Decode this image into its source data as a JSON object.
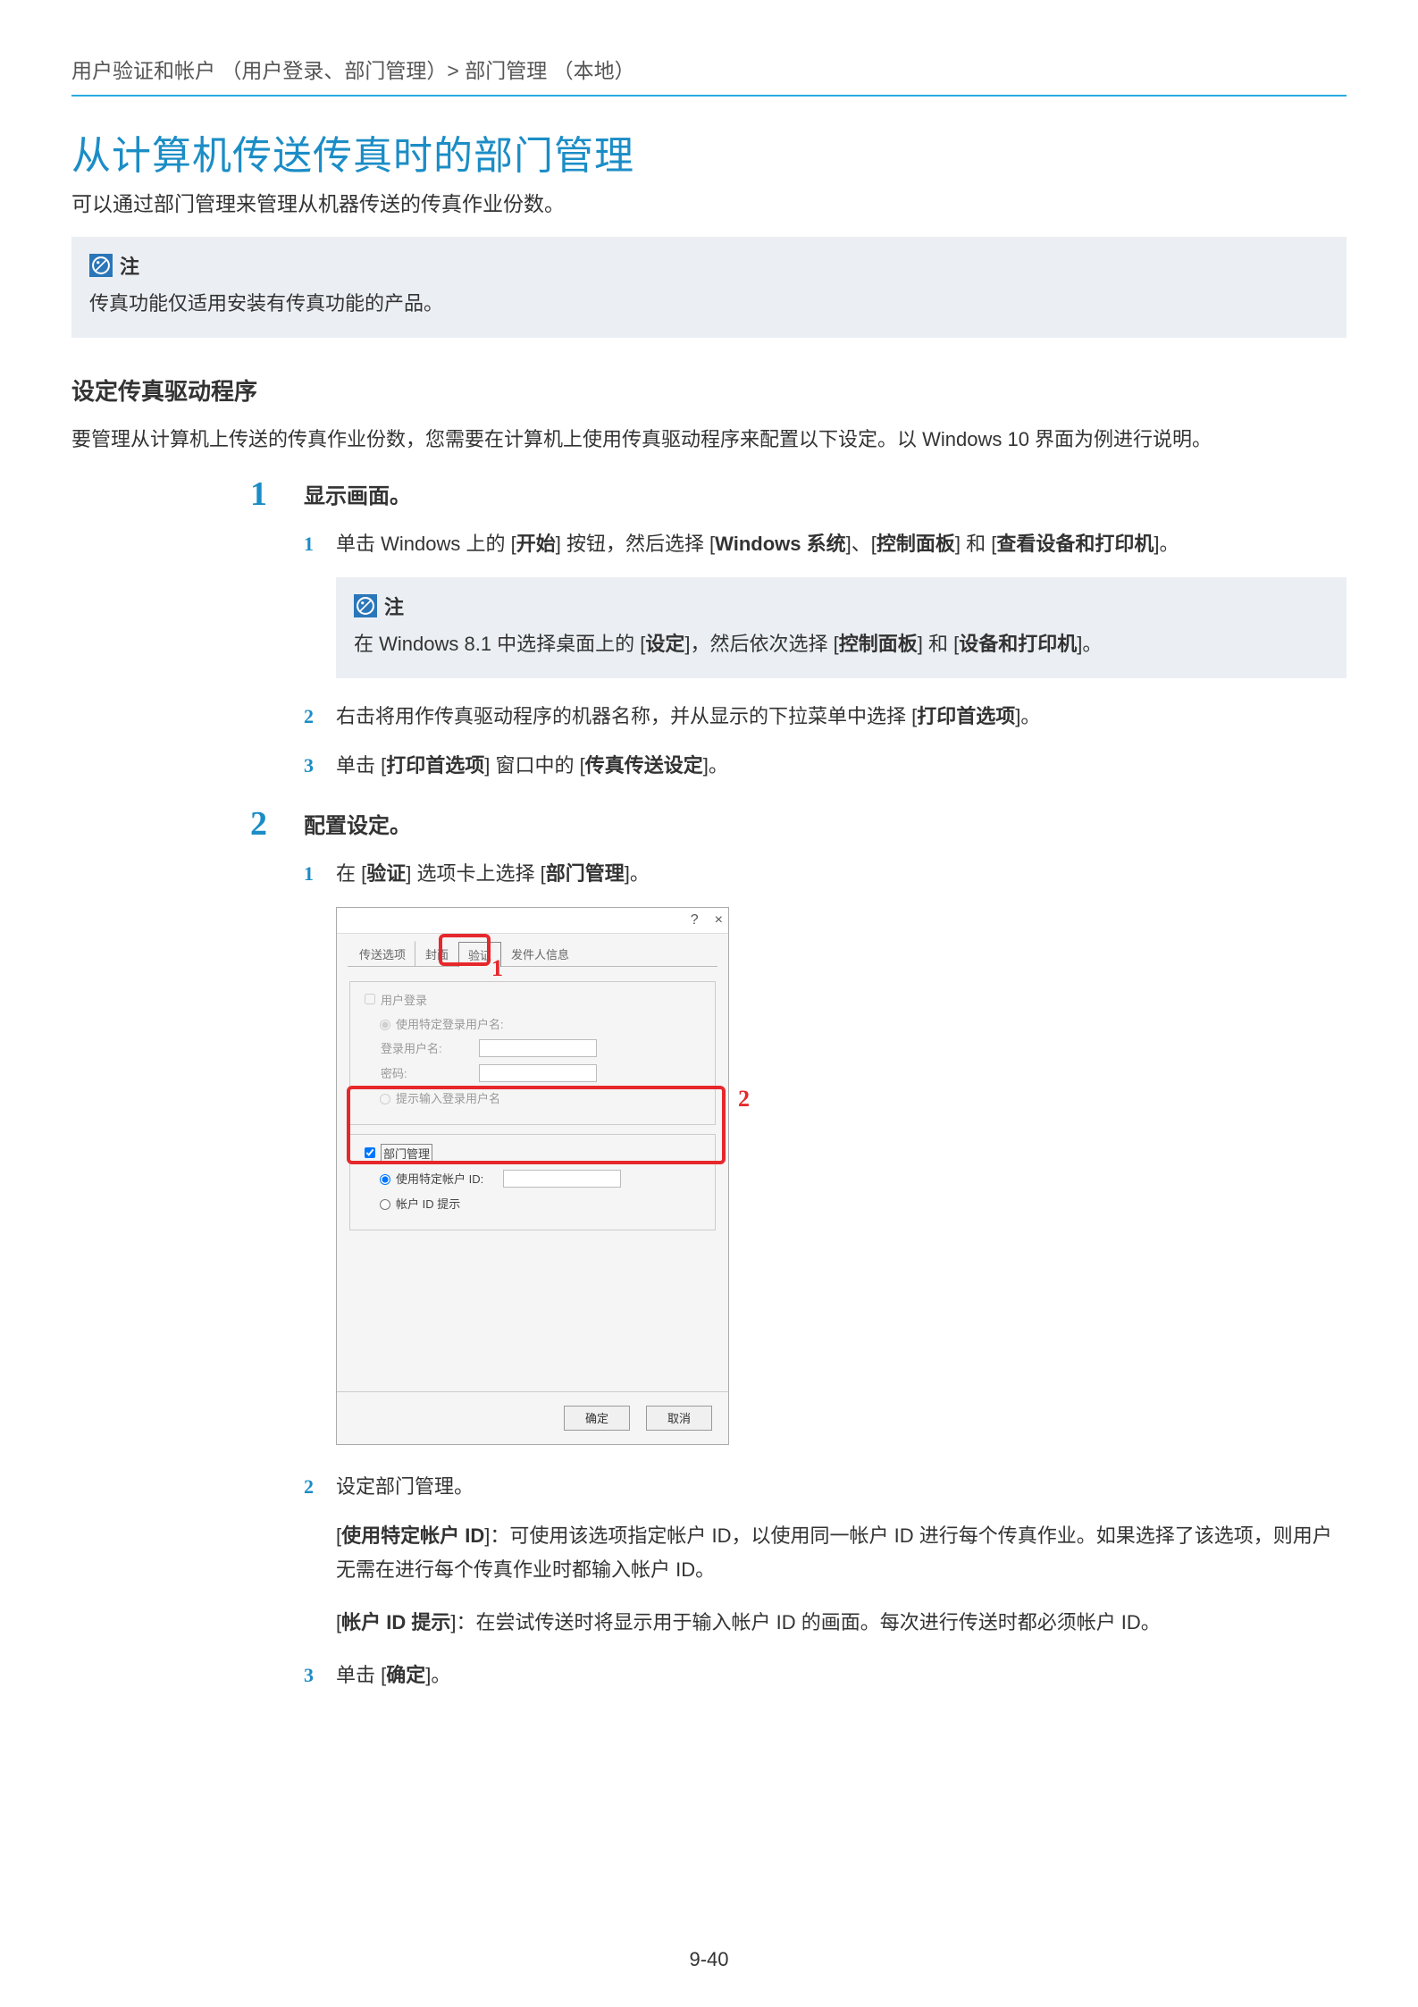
{
  "breadcrumb": "用户验证和帐户 （用户登录、部门管理）> 部门管理 （本地）",
  "main_title": "从计算机传送传真时的部门管理",
  "intro_para": "可以通过部门管理来管理从机器传送的传真作业份数。",
  "note_label": "注",
  "note1_body": "传真功能仅适用安装有传真功能的产品。",
  "section_heading": "设定传真驱动程序",
  "section_body": "要管理从计算机上传送的传真作业份数，您需要在计算机上使用传真驱动程序来配置以下设定。以 Windows 10 界面为例进行说明。",
  "step1": {
    "num": "1",
    "title": "显示画面。",
    "sub1": {
      "num": "1",
      "pre": "单击 Windows 上的 [",
      "b1": "开始",
      "mid1": "] 按钮，然后选择 [",
      "b2": "Windows 系统",
      "mid2": "]、[",
      "b3": "控制面板",
      "mid3": "] 和 [",
      "b4": "查看设备和打印机",
      "post": "]。"
    },
    "note2": {
      "pre": "在 Windows 8.1 中选择桌面上的 [",
      "b1": "设定",
      "mid1": "]，然后依次选择 [",
      "b2": "控制面板",
      "mid2": "] 和 [",
      "b3": "设备和打印机",
      "post": "]。"
    },
    "sub2": {
      "num": "2",
      "pre": "右击将用作传真驱动程序的机器名称，并从显示的下拉菜单中选择 [",
      "b1": "打印首选项",
      "post": "]。"
    },
    "sub3": {
      "num": "3",
      "pre": "单击 [",
      "b1": "打印首选项",
      "mid": "] 窗口中的 [",
      "b2": "传真传送设定",
      "post": "]。"
    }
  },
  "step2": {
    "num": "2",
    "title": "配置设定。",
    "sub1": {
      "num": "1",
      "pre": "在 [",
      "b1": "验证",
      "mid": "] 选项卡上选择 [",
      "b2": "部门管理",
      "post": "]。"
    },
    "sub2": {
      "num": "2",
      "text": "设定部门管理。"
    },
    "desc1": {
      "pre": "[",
      "b": "使用特定帐户 ID",
      "body": "]：可使用该选项指定帐户 ID，以使用同一帐户 ID 进行每个传真作业。如果选择了该选项，则用户无需在进行每个传真作业时都输入帐户 ID。"
    },
    "desc2": {
      "pre": "[",
      "b": "帐户 ID 提示",
      "body": "]：在尝试传送时将显示用于输入帐户 ID 的画面。每次进行传送时都必须帐户 ID。"
    },
    "sub3": {
      "num": "3",
      "pre": "单击 [",
      "b1": "确定",
      "post": "]。"
    }
  },
  "dialog": {
    "help": "?",
    "close": "×",
    "tab1": "传送选项",
    "tab2": "封面",
    "tab3": "验证",
    "tab4": "发件人信息",
    "user_login": "用户登录",
    "use_specific_user": "使用特定登录用户名:",
    "login_user": "登录用户名:",
    "password": "密码:",
    "prompt_user": "提示输入登录用户名",
    "dept_mgmt": "部门管理",
    "use_specific_acct": "使用特定帐户 ID:",
    "acct_prompt": "帐户 ID 提示",
    "ok": "确定",
    "cancel": "取消",
    "callout1": "1",
    "callout2": "2"
  },
  "page_num": "9-40"
}
